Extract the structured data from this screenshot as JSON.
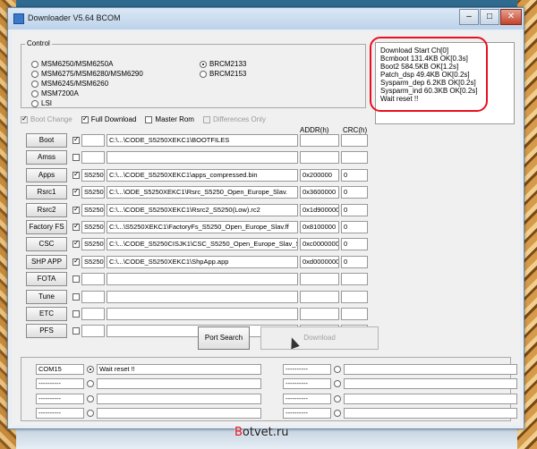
{
  "window": {
    "title": "Downloader V5.64 BCOM"
  },
  "control": {
    "label": "Control",
    "chips": [
      {
        "label": "MSM6250/MSM6250A",
        "selected": false
      },
      {
        "label": "MSM6275/MSM6280/MSM6290",
        "selected": false
      },
      {
        "label": "MSM6245/MSM6260",
        "selected": false
      },
      {
        "label": "MSM7200A",
        "selected": false
      },
      {
        "label": "LSI",
        "selected": false
      },
      {
        "label": "BRCM2133",
        "selected": true
      },
      {
        "label": "BRCM2153",
        "selected": false
      }
    ]
  },
  "log": {
    "lines": [
      "Download Start Ch[0]",
      "Bcmboot 131.4KB OK[0.3s]",
      "Boot2 584.5KB OK[1.2s]",
      "Patch_dsp 49.4KB OK[0.2s]",
      "Sysparm_dep 6.2KB OK[0.2s]",
      "Sysparm_ind 60.3KB OK[0.2s]",
      "Wait reset !!"
    ]
  },
  "options": {
    "boot_change": "Boot Change",
    "full_download": "Full Download",
    "master_rom": "Master Rom",
    "differences_only": "Differences Only"
  },
  "headers": {
    "addr": "ADDR(h)",
    "crc": "CRC(h)"
  },
  "rows": [
    {
      "label": "Boot",
      "checked": true,
      "chip": "",
      "path": "C:\\...\\CODE_S5250XEKC1\\BOOTFILES",
      "addr": "",
      "crc": ""
    },
    {
      "label": "Amss",
      "checked": false,
      "chip": "",
      "path": "",
      "addr": "",
      "crc": ""
    },
    {
      "label": "Apps",
      "checked": true,
      "chip": "S5250",
      "path": "C:\\...\\CODE_S5250XEKC1\\apps_compressed.bin",
      "addr": "0x200000",
      "crc": "0"
    },
    {
      "label": "Rsrc1",
      "checked": true,
      "chip": "S5250",
      "path": "C:\\...\\ODE_S5250XEKC1\\Rsrc_S5250_Open_Europe_Slav.",
      "addr": "0x3600000",
      "crc": "0"
    },
    {
      "label": "Rsrc2",
      "checked": true,
      "chip": "S5250",
      "path": "C:\\...\\CODE_S5250XEKC1\\Rsrc2_S5250(Low).rc2",
      "addr": "0x1d900000",
      "crc": "0"
    },
    {
      "label": "Factory FS",
      "checked": true,
      "chip": "S5250",
      "path": "C:\\...\\S5250XEKC1\\FactoryFs_S5250_Open_Europe_Slav.ff",
      "addr": "0x8100000",
      "crc": "0"
    },
    {
      "label": "CSC",
      "checked": true,
      "chip": "S5250",
      "path": "C:\\...\\CODE_S5250CISJK1\\CSC_S5250_Open_Europe_Slav_SER.",
      "addr": "0xc0000000",
      "crc": "0"
    },
    {
      "label": "SHP APP",
      "checked": true,
      "chip": "S5250",
      "path": "C:\\...\\CODE_S5250XEKC1\\ShpApp.app",
      "addr": "0xd0000000",
      "crc": "0"
    },
    {
      "label": "FOTA",
      "checked": false,
      "chip": "",
      "path": "",
      "addr": "",
      "crc": ""
    },
    {
      "label": "Tune",
      "checked": false,
      "chip": "",
      "path": "",
      "addr": "",
      "crc": ""
    },
    {
      "label": "ETC",
      "checked": false,
      "chip": "",
      "path": "",
      "addr": "",
      "crc": ""
    },
    {
      "label": "PFS",
      "checked": false,
      "chip": "",
      "path": "",
      "addr": "",
      "crc": ""
    }
  ],
  "buttons": {
    "port_search": "Port Search",
    "download": "Download"
  },
  "ports": [
    {
      "name": "COM15",
      "status": "Wait reset !!",
      "active": true
    },
    {
      "name": "----------",
      "status": "",
      "active": false
    },
    {
      "name": "----------",
      "status": "",
      "active": false
    },
    {
      "name": "----------",
      "status": "",
      "active": false
    },
    {
      "name": "----------",
      "status": "",
      "active": false
    },
    {
      "name": "----------",
      "status": "",
      "active": false
    },
    {
      "name": "----------",
      "status": "",
      "active": false
    },
    {
      "name": "----------",
      "status": "",
      "active": false
    }
  ],
  "watermark": {
    "b": "B",
    "rest": "otvet.ru"
  }
}
